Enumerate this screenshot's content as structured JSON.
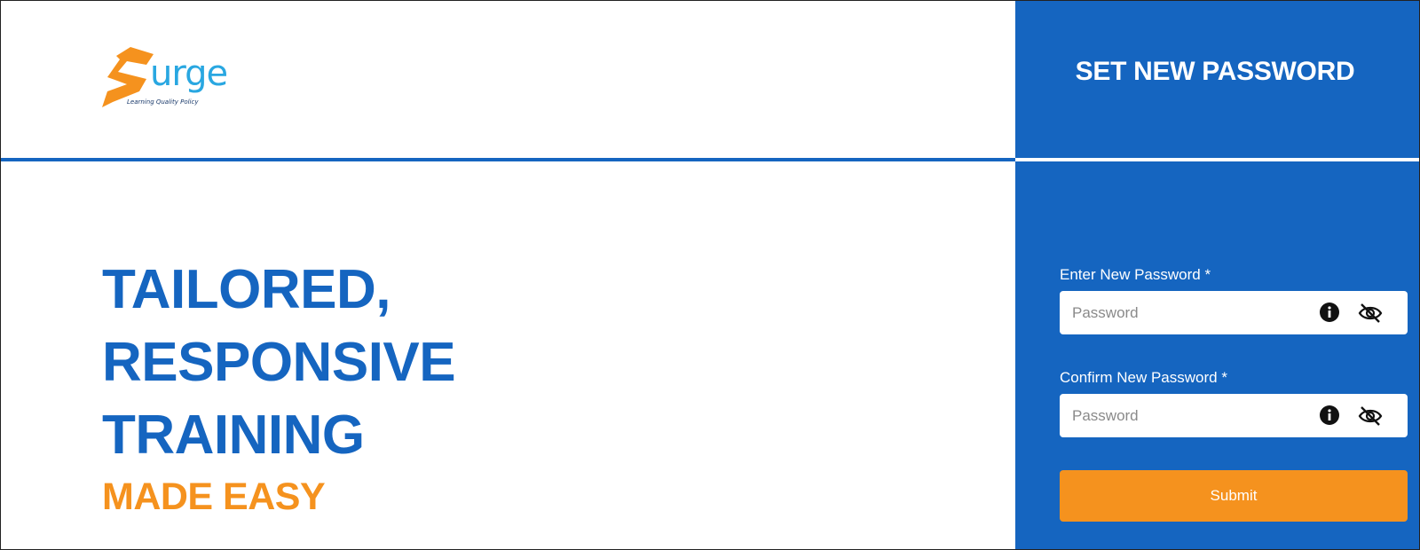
{
  "brand": {
    "logo_word": "urge",
    "logo_tagline": "Learning Quality Policy",
    "colors": {
      "blue": "#1565c0",
      "orange": "#f5921e",
      "logo_cyan": "#29a7e1"
    }
  },
  "hero": {
    "line1": "TAILORED,",
    "line2": "RESPONSIVE",
    "line3": "TRAINING",
    "accent": "MADE EASY"
  },
  "panel": {
    "title": "SET NEW PASSWORD",
    "new_password": {
      "label": "Enter New Password *",
      "placeholder": "Password",
      "value": "",
      "icons": [
        "info-icon",
        "eye-slash-icon"
      ]
    },
    "confirm_password": {
      "label": "Confirm New Password *",
      "placeholder": "Password",
      "value": "",
      "icons": [
        "info-icon",
        "eye-slash-icon"
      ]
    },
    "submit_label": "Submit"
  }
}
